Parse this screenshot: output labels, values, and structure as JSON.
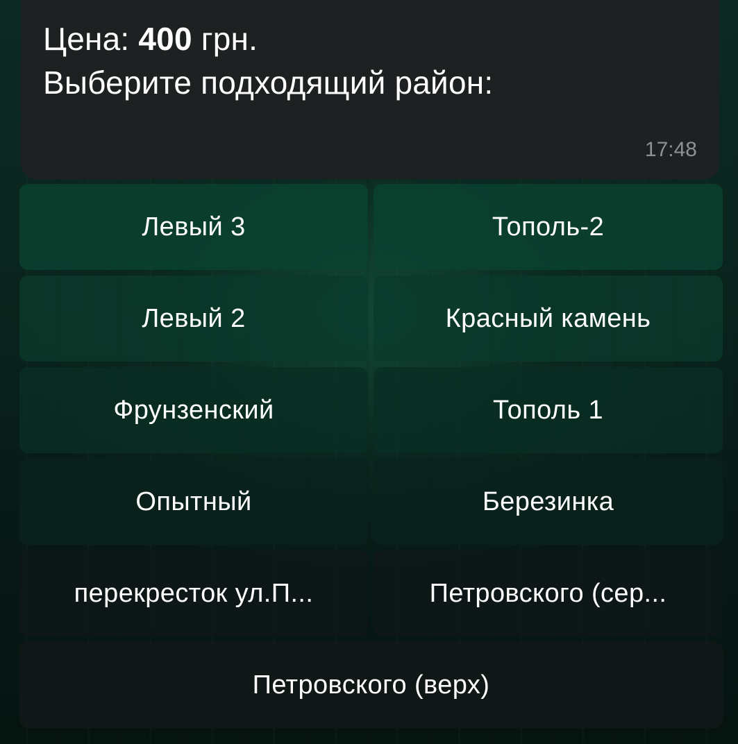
{
  "message": {
    "price_label": "Цена:",
    "price_value": "400",
    "price_unit": "грн.",
    "prompt": "Выберите подходящий район:",
    "time": "17:48"
  },
  "keyboard": {
    "buttons": [
      "Левый 3",
      "Тополь-2",
      "Левый 2",
      "Красный камень",
      "Фрунзенский",
      "Тополь 1",
      "Опытный",
      "Березинка",
      "перекресток ул.П...",
      "Петровского (сер...",
      "Петровского (верх)"
    ]
  }
}
